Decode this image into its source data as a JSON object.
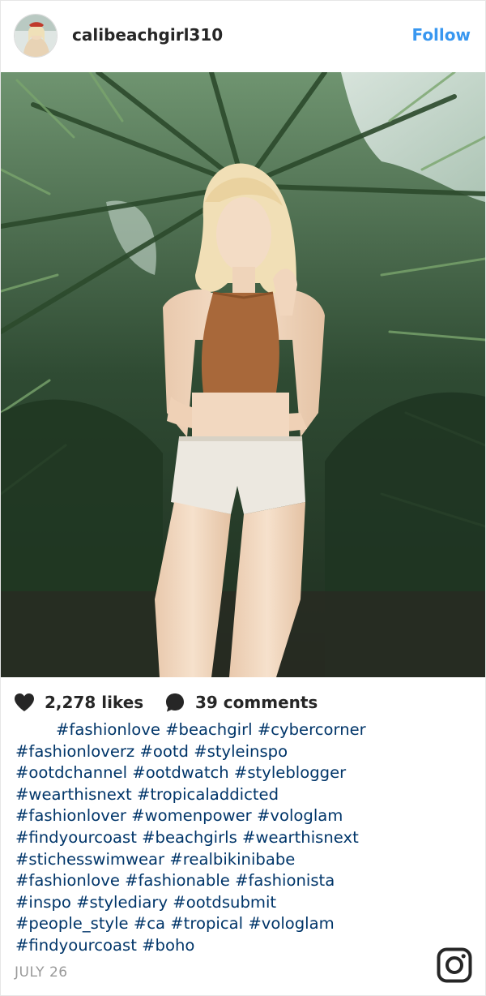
{
  "header": {
    "username": "calibeachgirl310",
    "follow_label": "Follow"
  },
  "stats": {
    "likes": "2,278 likes",
    "comments": "39 comments"
  },
  "caption": {
    "lines": [
      "#fashionlove #beachgirl #cybercorner",
      "#fashionloverz #ootd #styleinspo",
      "#ootdchannel #ootdwatch #styleblogger",
      "#wearthisnext #tropicaladdicted",
      "#fashionlover #womenpower #vologlam",
      "#findyourcoast #beachgirls #wearthisnext",
      "#stichesswimwear #realbikinibabe",
      "#fashionlove #fashionable #fashionista",
      "#inspo #stylediary #ootdsubmit",
      "#people_style #ca #tropical #vologlam",
      "#findyourcoast #boho"
    ]
  },
  "footer": {
    "date": "JULY 26"
  },
  "colors": {
    "link": "#003569",
    "follow": "#3897f0",
    "text": "#262626",
    "muted": "#999999"
  },
  "icons": {
    "likes": "heart-icon",
    "comments": "comment-bubble-icon",
    "brand": "instagram-logo-icon"
  }
}
